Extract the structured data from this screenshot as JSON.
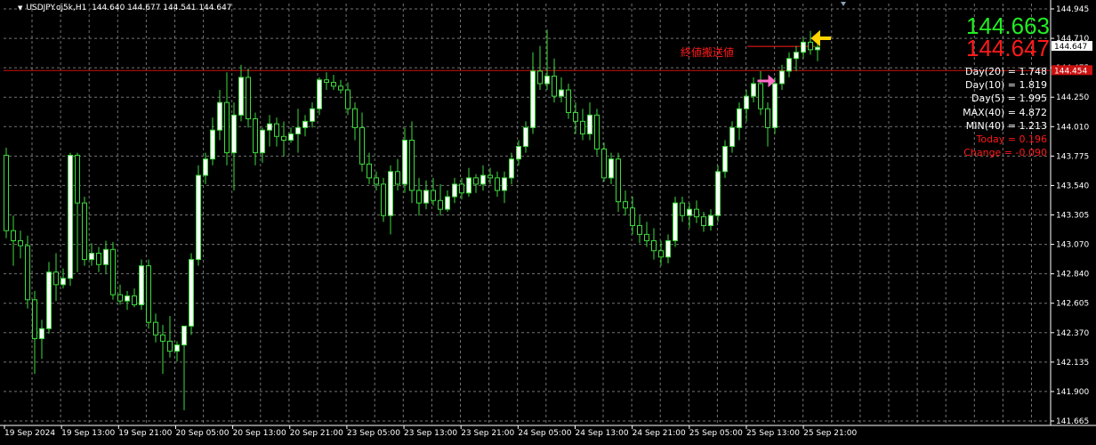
{
  "header": {
    "symbol_line": "USDJPY.oj5k,H1",
    "ohlc": "144.640 144.677 144.541 144.647"
  },
  "quotes": {
    "bid": "144.663",
    "ask": "144.647",
    "close_label": "終値搬送値",
    "ask_tag": "144.647",
    "red_line_tag": "144.454"
  },
  "stats": [
    {
      "text": "Day(20) = 1.748",
      "color": "white"
    },
    {
      "text": "Day(10) = 1.819",
      "color": "white"
    },
    {
      "text": "Day(5) = 1.995",
      "color": "white"
    },
    {
      "text": "MAX(40) = 4.872",
      "color": "white"
    },
    {
      "text": "MIN(40) = 1.213",
      "color": "white"
    },
    {
      "text": "Today = 0.196",
      "color": "red"
    },
    {
      "text": "Change = -0.090",
      "color": "red"
    }
  ],
  "colors": {
    "background": "#000000",
    "grid": "#9a9a9a",
    "candle": "#3ddc3d",
    "bull_body": "#ffffff",
    "bear_body": "#000000",
    "bid": "#22ee22",
    "ask": "#ff1a1a",
    "red_level": "#cc1111",
    "arrow_pink": "#ff6ec7",
    "arrow_yellow": "#ffd400"
  },
  "icons": {
    "entry_arrow": "pink-right-arrow-icon",
    "signal_arrow": "yellow-left-arrow-icon",
    "symbol_dropdown": "triangle-down-icon"
  },
  "chart_data": {
    "type": "candlestick",
    "timeframe": "H1",
    "y_axis": {
      "min": 141.665,
      "max": 144.945,
      "ticks": [
        "144.945",
        "144.710",
        "144.475",
        "144.250",
        "144.010",
        "143.775",
        "143.540",
        "143.305",
        "143.070",
        "142.840",
        "142.605",
        "142.370",
        "142.135",
        "141.900",
        "141.665"
      ]
    },
    "x_axis": {
      "labels": [
        "19 Sep 2024",
        "19 Sep 13:00",
        "19 Sep 21:00",
        "20 Sep 05:00",
        "20 Sep 13:00",
        "20 Sep 21:00",
        "23 Sep 05:00",
        "23 Sep 13:00",
        "23 Sep 21:00",
        "24 Sep 05:00",
        "24 Sep 13:00",
        "24 Sep 21:00",
        "25 Sep 05:00",
        "25 Sep 13:00",
        "25 Sep 21:00"
      ]
    },
    "levels": {
      "red_line": 144.454,
      "close_line": 144.647
    },
    "candles": [
      [
        143.78,
        143.84,
        143.12,
        143.18
      ],
      [
        143.18,
        143.3,
        142.9,
        143.1
      ],
      [
        143.1,
        143.18,
        142.96,
        143.06
      ],
      [
        143.06,
        143.14,
        142.56,
        142.63
      ],
      [
        142.63,
        142.7,
        142.04,
        142.32
      ],
      [
        142.32,
        142.47,
        142.16,
        142.4
      ],
      [
        142.4,
        142.93,
        142.36,
        142.85
      ],
      [
        142.85,
        143.0,
        142.62,
        142.75
      ],
      [
        142.75,
        142.88,
        142.72,
        142.8
      ],
      [
        142.8,
        143.8,
        142.74,
        143.78
      ],
      [
        143.78,
        143.8,
        142.85,
        143.4
      ],
      [
        143.4,
        143.45,
        142.9,
        142.95
      ],
      [
        142.95,
        143.08,
        142.9,
        143.0
      ],
      [
        143.0,
        143.05,
        142.85,
        142.91
      ],
      [
        142.91,
        143.1,
        142.84,
        143.03
      ],
      [
        143.03,
        143.09,
        142.63,
        142.67
      ],
      [
        142.67,
        142.75,
        142.59,
        142.62
      ],
      [
        142.62,
        142.7,
        142.55,
        142.66
      ],
      [
        142.66,
        142.72,
        142.57,
        142.59
      ],
      [
        142.59,
        142.95,
        142.55,
        142.9
      ],
      [
        142.9,
        142.95,
        142.4,
        142.45
      ],
      [
        142.45,
        142.52,
        142.29,
        142.35
      ],
      [
        142.35,
        142.43,
        142.04,
        142.3
      ],
      [
        142.3,
        142.5,
        142.17,
        142.22
      ],
      [
        142.22,
        142.3,
        142.14,
        142.27
      ],
      [
        142.27,
        142.35,
        141.75,
        142.42
      ],
      [
        142.42,
        143.0,
        142.35,
        142.95
      ],
      [
        142.95,
        143.7,
        142.9,
        143.62
      ],
      [
        143.62,
        143.8,
        143.55,
        143.75
      ],
      [
        143.75,
        144.08,
        143.7,
        143.98
      ],
      [
        143.98,
        144.3,
        143.9,
        144.2
      ],
      [
        144.2,
        144.44,
        143.7,
        143.8
      ],
      [
        143.8,
        144.2,
        143.5,
        144.1
      ],
      [
        144.1,
        144.5,
        144.05,
        144.4
      ],
      [
        144.4,
        144.47,
        144.0,
        144.07
      ],
      [
        144.07,
        144.12,
        143.7,
        143.8
      ],
      [
        143.8,
        144.0,
        143.72,
        143.98
      ],
      [
        143.98,
        144.1,
        143.85,
        144.03
      ],
      [
        144.03,
        144.08,
        143.85,
        143.93
      ],
      [
        143.93,
        144.05,
        143.77,
        143.9
      ],
      [
        143.9,
        144.0,
        143.88,
        143.95
      ],
      [
        143.95,
        144.15,
        143.8,
        144.0
      ],
      [
        144.0,
        144.1,
        143.93,
        144.05
      ],
      [
        144.05,
        144.2,
        144.0,
        144.15
      ],
      [
        144.15,
        144.4,
        144.1,
        144.38
      ],
      [
        144.38,
        144.44,
        144.3,
        144.36
      ],
      [
        144.36,
        144.42,
        144.3,
        144.33
      ],
      [
        144.33,
        144.38,
        144.27,
        144.3
      ],
      [
        144.3,
        144.36,
        144.1,
        144.15
      ],
      [
        144.15,
        144.2,
        143.9,
        144.0
      ],
      [
        144.0,
        144.12,
        143.65,
        143.71
      ],
      [
        143.71,
        143.8,
        143.55,
        143.6
      ],
      [
        143.6,
        143.65,
        143.5,
        143.55
      ],
      [
        143.55,
        143.6,
        143.25,
        143.3
      ],
      [
        143.3,
        143.7,
        143.15,
        143.65
      ],
      [
        143.65,
        143.75,
        143.5,
        143.55
      ],
      [
        143.55,
        144.0,
        143.48,
        143.9
      ],
      [
        143.9,
        144.05,
        143.4,
        143.5
      ],
      [
        143.5,
        143.6,
        143.3,
        143.4
      ],
      [
        143.4,
        143.58,
        143.35,
        143.5
      ],
      [
        143.5,
        143.6,
        143.38,
        143.42
      ],
      [
        143.42,
        143.55,
        143.3,
        143.35
      ],
      [
        143.35,
        143.5,
        143.33,
        143.45
      ],
      [
        143.45,
        143.6,
        143.4,
        143.55
      ],
      [
        143.55,
        143.6,
        143.43,
        143.48
      ],
      [
        143.48,
        143.68,
        143.45,
        143.6
      ],
      [
        143.6,
        143.63,
        143.48,
        143.55
      ],
      [
        143.55,
        143.7,
        143.5,
        143.62
      ],
      [
        143.62,
        143.68,
        143.55,
        143.6
      ],
      [
        143.6,
        143.65,
        143.45,
        143.5
      ],
      [
        143.5,
        143.65,
        143.4,
        143.6
      ],
      [
        143.6,
        143.8,
        143.55,
        143.75
      ],
      [
        143.75,
        143.9,
        143.7,
        143.85
      ],
      [
        143.85,
        144.05,
        143.8,
        144.0
      ],
      [
        144.0,
        144.6,
        143.95,
        144.45
      ],
      [
        144.45,
        144.65,
        144.3,
        144.35
      ],
      [
        144.35,
        144.78,
        144.3,
        144.41
      ],
      [
        144.41,
        144.55,
        144.2,
        144.25
      ],
      [
        144.25,
        144.4,
        144.2,
        144.3
      ],
      [
        144.3,
        144.35,
        144.07,
        144.12
      ],
      [
        144.12,
        144.2,
        143.95,
        144.05
      ],
      [
        144.05,
        144.15,
        143.9,
        143.95
      ],
      [
        143.95,
        144.2,
        143.9,
        144.1
      ],
      [
        144.1,
        144.15,
        143.78,
        143.83
      ],
      [
        143.83,
        143.88,
        143.57,
        143.6
      ],
      [
        143.6,
        143.8,
        143.55,
        143.75
      ],
      [
        143.75,
        143.8,
        143.33,
        143.41
      ],
      [
        143.41,
        143.5,
        143.3,
        143.36
      ],
      [
        143.36,
        143.45,
        143.15,
        143.22
      ],
      [
        143.22,
        143.3,
        143.08,
        143.15
      ],
      [
        143.15,
        143.25,
        143.05,
        143.1
      ],
      [
        143.1,
        143.2,
        142.95,
        143.02
      ],
      [
        143.02,
        143.1,
        142.9,
        142.97
      ],
      [
        142.97,
        143.15,
        142.92,
        143.1
      ],
      [
        143.1,
        143.45,
        143.05,
        143.4
      ],
      [
        143.4,
        143.45,
        143.25,
        143.3
      ],
      [
        143.3,
        143.4,
        143.2,
        143.35
      ],
      [
        143.35,
        143.42,
        143.24,
        143.29
      ],
      [
        143.29,
        143.33,
        143.17,
        143.22
      ],
      [
        143.22,
        143.35,
        143.18,
        143.3
      ],
      [
        143.3,
        143.7,
        143.25,
        143.65
      ],
      [
        143.65,
        143.9,
        143.6,
        143.85
      ],
      [
        143.85,
        144.05,
        143.8,
        144.0
      ],
      [
        144.0,
        144.2,
        143.9,
        144.15
      ],
      [
        144.15,
        144.3,
        144.05,
        144.25
      ],
      [
        144.25,
        144.4,
        144.2,
        144.35
      ],
      [
        144.35,
        144.45,
        144.1,
        144.15
      ],
      [
        144.15,
        144.2,
        143.85,
        144.0
      ],
      [
        144.0,
        144.4,
        143.95,
        144.35
      ],
      [
        144.35,
        144.5,
        144.3,
        144.45
      ],
      [
        144.45,
        144.6,
        144.4,
        144.55
      ],
      [
        144.55,
        144.65,
        144.45,
        144.6
      ],
      [
        144.6,
        144.72,
        144.55,
        144.68
      ],
      [
        144.68,
        144.77,
        144.58,
        144.62
      ],
      [
        144.62,
        144.68,
        144.53,
        144.64
      ]
    ]
  }
}
